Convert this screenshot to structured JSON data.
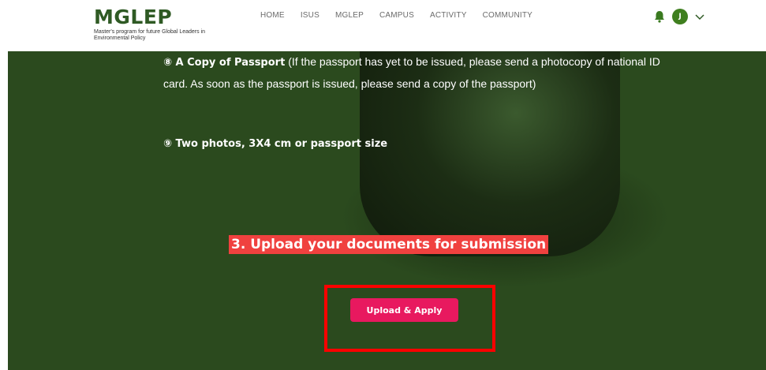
{
  "header": {
    "logo_title": "MGLEP",
    "logo_subtitle": "Master's program for future Global Leaders in Environmental Policy",
    "nav": [
      "HOME",
      "ISUS",
      "MGLEP",
      "CAMPUS",
      "ACTIVITY",
      "COMMUNITY"
    ],
    "avatar_initial": "J"
  },
  "content": {
    "item8_bold": "⑧ A Copy of Passport",
    "item8_rest": " (If the passport has yet to be issued, please send a photocopy of national ID card. As soon as the passport is issued, please send a copy of the passport)",
    "item9": "⑨ Two photos, 3X4 cm or passport size",
    "section_title": "3. Upload your documents for submission",
    "upload_button": "Upload & Apply"
  },
  "colors": {
    "brand_green": "#2f5a24",
    "background_green": "#2b4a1e",
    "avatar_green": "#3f7f1f",
    "section_title_bg": "#f0413f",
    "button_pink": "#e8195f",
    "highlight_red": "#ff0000"
  },
  "icons": [
    "bell-icon",
    "chevron-down-icon"
  ]
}
